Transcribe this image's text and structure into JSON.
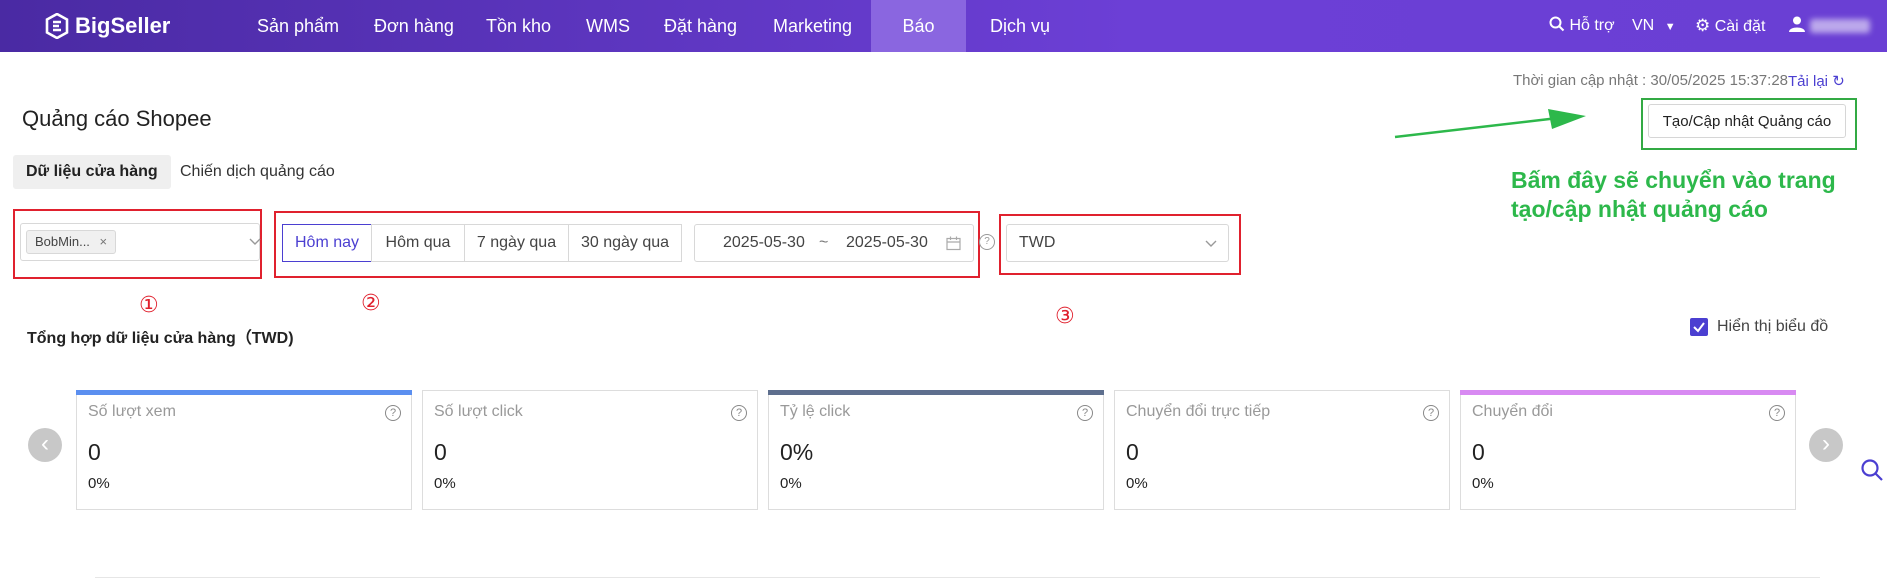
{
  "nav": {
    "logo": "BigSeller",
    "items": [
      "Sản phẩm",
      "Đơn hàng",
      "Tồn kho",
      "WMS",
      "Đặt hàng",
      "Marketing",
      "Báo cáo",
      "Dịch vụ"
    ],
    "active_item": "Báo cáo",
    "support": "Hỗ trợ",
    "language": "VN",
    "settings": "Cài đặt"
  },
  "header": {
    "update_time": "Thời gian cập nhật : 30/05/2025 15:37:28",
    "reload": "Tải lại",
    "title": "Quảng cáo Shopee",
    "create_button": "Tạo/Cập nhật Quảng cáo",
    "annotation_line1": "Bấm đây sẽ chuyển vào trang",
    "annotation_line2": "tạo/cập nhật quảng cáo"
  },
  "tabs": [
    "Dữ liệu cửa hàng",
    "Chiến dịch quảng cáo"
  ],
  "filters": {
    "store_tag": "BobMin...",
    "date_ranges": [
      "Hôm nay",
      "Hôm qua",
      "7 ngày qua",
      "30 ngày qua"
    ],
    "date_start": "2025-05-30",
    "date_sep": "~",
    "date_end": "2025-05-30",
    "currency": "TWD",
    "markers": [
      "①",
      "②",
      "③"
    ]
  },
  "summary": {
    "title": "Tổng hợp dữ liệu cửa hàng（TWD)",
    "show_chart": "Hiển thị biểu đồ"
  },
  "cards": [
    {
      "label": "Số lượt xem",
      "value": "0",
      "pct": "0%",
      "color": "#5b8ff0"
    },
    {
      "label": "Số lượt click",
      "value": "0",
      "pct": "0%",
      "color": ""
    },
    {
      "label": "Tỷ lệ click",
      "value": "0%",
      "pct": "0%",
      "color": "#5e6f8e"
    },
    {
      "label": "Chuyển đổi trực tiếp",
      "value": "0",
      "pct": "0%",
      "color": ""
    },
    {
      "label": "Chuyển đổi",
      "value": "0",
      "pct": "0%",
      "color": "#d88af2"
    }
  ]
}
